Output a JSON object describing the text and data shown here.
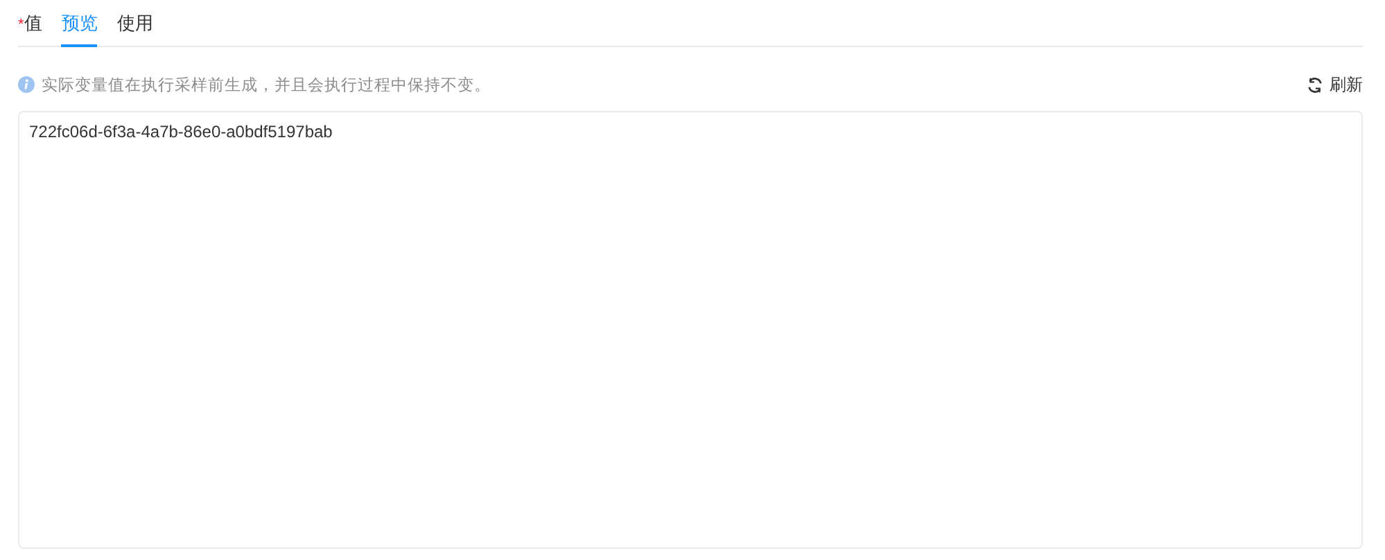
{
  "tabs": [
    {
      "label": "值",
      "required_mark": "*",
      "selected": false
    },
    {
      "label": "预览",
      "selected": true
    },
    {
      "label": "使用",
      "selected": false
    }
  ],
  "notice": "实际变量值在执行采样前生成，并且会执行过程中保持不变。",
  "refresh_button": "刷新",
  "preview": {
    "value": "722fc06d-6f3a-4a7b-86e0-a0bdf5197bab"
  }
}
